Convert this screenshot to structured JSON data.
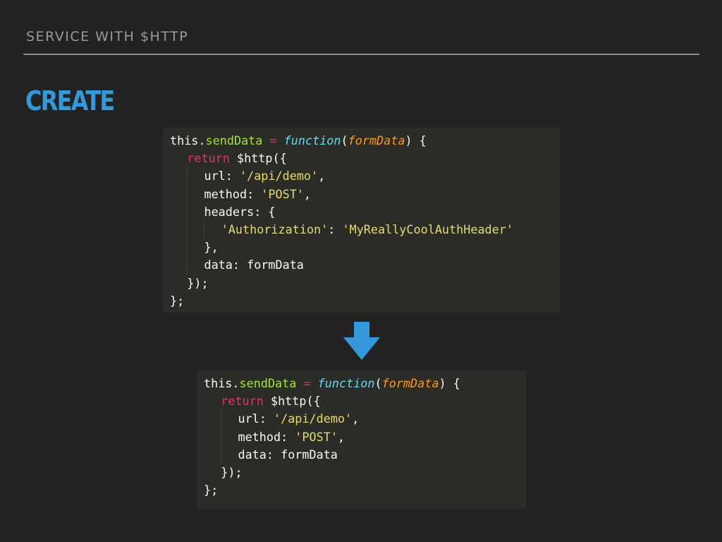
{
  "header": {
    "section_title": "SERVICE WITH $HTTP",
    "slide_heading": "CREATE",
    "accent_color": "#3498db"
  },
  "code_before": {
    "line1": {
      "obj": "this",
      "dot": ".",
      "prop": "sendData",
      "eq": " = ",
      "fn": "function",
      "open": "(",
      "param": "formData",
      "close": ") {"
    },
    "line2": {
      "ret": "return",
      "rest": " $http({"
    },
    "line3": {
      "key": "url: ",
      "val": "'/api/demo'",
      "end": ","
    },
    "line4": {
      "key": "method: ",
      "val": "'POST'",
      "end": ","
    },
    "line5": {
      "text": "headers: {"
    },
    "line6": {
      "key": "'Authorization'",
      "sep": ": ",
      "val": "'MyReallyCoolAuthHeader'"
    },
    "line7": {
      "text": "},"
    },
    "line8": {
      "text": "data: formData"
    },
    "line9": {
      "text": "});"
    },
    "line10": {
      "text": "};"
    }
  },
  "transition_icon": "arrow-down-icon",
  "code_after": {
    "line1": {
      "obj": "this",
      "dot": ".",
      "prop": "sendData",
      "eq": " = ",
      "fn": "function",
      "open": "(",
      "param": "formData",
      "close": ") {"
    },
    "line2": {
      "ret": "return",
      "rest": " $http({"
    },
    "line3": {
      "key": "url: ",
      "val": "'/api/demo'",
      "end": ","
    },
    "line4": {
      "key": "method: ",
      "val": "'POST'",
      "end": ","
    },
    "line5": {
      "text": "data: formData"
    },
    "line6": {
      "text": "});"
    },
    "line7": {
      "text": "};"
    }
  }
}
